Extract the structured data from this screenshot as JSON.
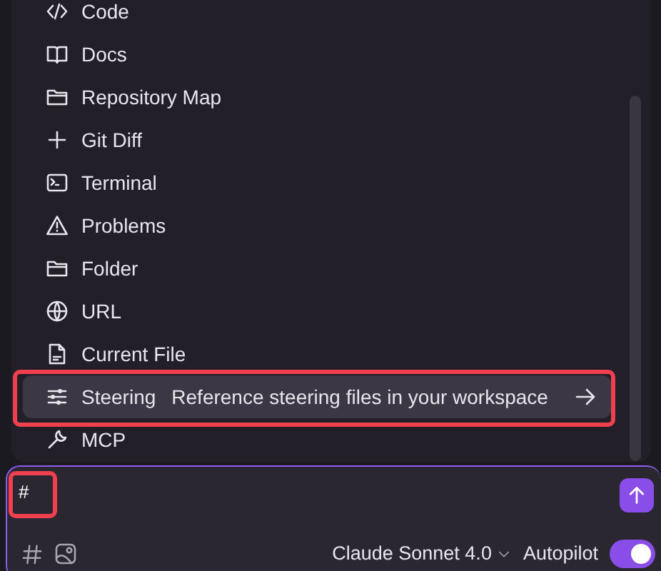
{
  "menu": {
    "items": [
      {
        "label": "Code",
        "selected": false
      },
      {
        "label": "Docs",
        "selected": false
      },
      {
        "label": "Repository Map",
        "selected": false
      },
      {
        "label": "Git Diff",
        "selected": false
      },
      {
        "label": "Terminal",
        "selected": false
      },
      {
        "label": "Problems",
        "selected": false
      },
      {
        "label": "Folder",
        "selected": false
      },
      {
        "label": "URL",
        "selected": false
      },
      {
        "label": "Current File",
        "selected": false
      },
      {
        "label": "Steering",
        "description": "Reference steering files in your workspace",
        "selected": true,
        "annotated": true
      },
      {
        "label": "MCP",
        "selected": false
      }
    ]
  },
  "input": {
    "value": "#",
    "annotated": true
  },
  "footer": {
    "model": "Claude Sonnet 4.0",
    "mode": {
      "label": "Autopilot",
      "on": true
    }
  }
}
